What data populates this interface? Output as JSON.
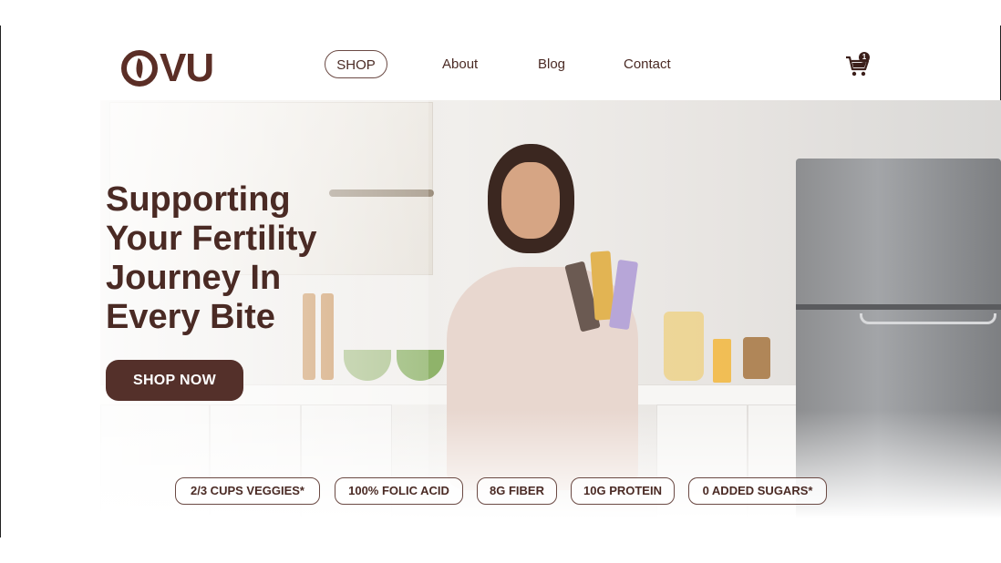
{
  "brand": {
    "logo_text": "VU"
  },
  "nav": {
    "shop_label": "SHOP",
    "about_label": "About",
    "blog_label": "Blog",
    "contact_label": "Contact"
  },
  "cart": {
    "icon": "shopping-cart-icon",
    "count": "1"
  },
  "hero": {
    "headline_line1": "Supporting",
    "headline_line2": "Your Fertility",
    "headline_line3": "Journey In",
    "headline_line4": "Every Bite",
    "cta_label": "SHOP NOW"
  },
  "features": [
    {
      "label": "2/3 CUPS VEGGIES*"
    },
    {
      "label": "100% FOLIC ACID"
    },
    {
      "label": "8G FIBER"
    },
    {
      "label": "10G PROTEIN"
    },
    {
      "label": "0 ADDED SUGARS*"
    }
  ],
  "colors": {
    "brand_brown": "#54302a",
    "text_brown": "#4a2a24",
    "background": "#ffffff"
  }
}
